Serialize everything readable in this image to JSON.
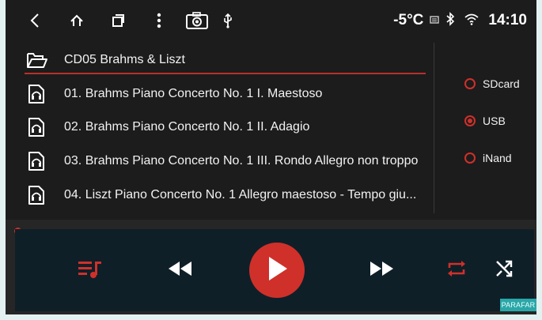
{
  "status": {
    "temperature": "-5°C",
    "time": "14:10"
  },
  "folder": {
    "name": "CD05 Brahms & Liszt"
  },
  "tracks": [
    {
      "title": "01. Brahms Piano Concerto No. 1 I. Maestoso"
    },
    {
      "title": "02. Brahms Piano Concerto No. 1 II. Adagio"
    },
    {
      "title": "03. Brahms Piano Concerto No. 1 III. Rondo Allegro non troppo"
    },
    {
      "title": "04. Liszt Piano Concerto No. 1 Allegro maestoso - Tempo giu..."
    }
  ],
  "storage": {
    "options": [
      {
        "label": "SDcard",
        "selected": false
      },
      {
        "label": "USB",
        "selected": true
      },
      {
        "label": "iNand",
        "selected": false
      }
    ]
  },
  "watermark": "PARAFAR",
  "colors": {
    "accent": "#d0302a",
    "background": "#1c1c1c",
    "player_panel": "#0f1f28",
    "text": "#f2f2f2"
  }
}
